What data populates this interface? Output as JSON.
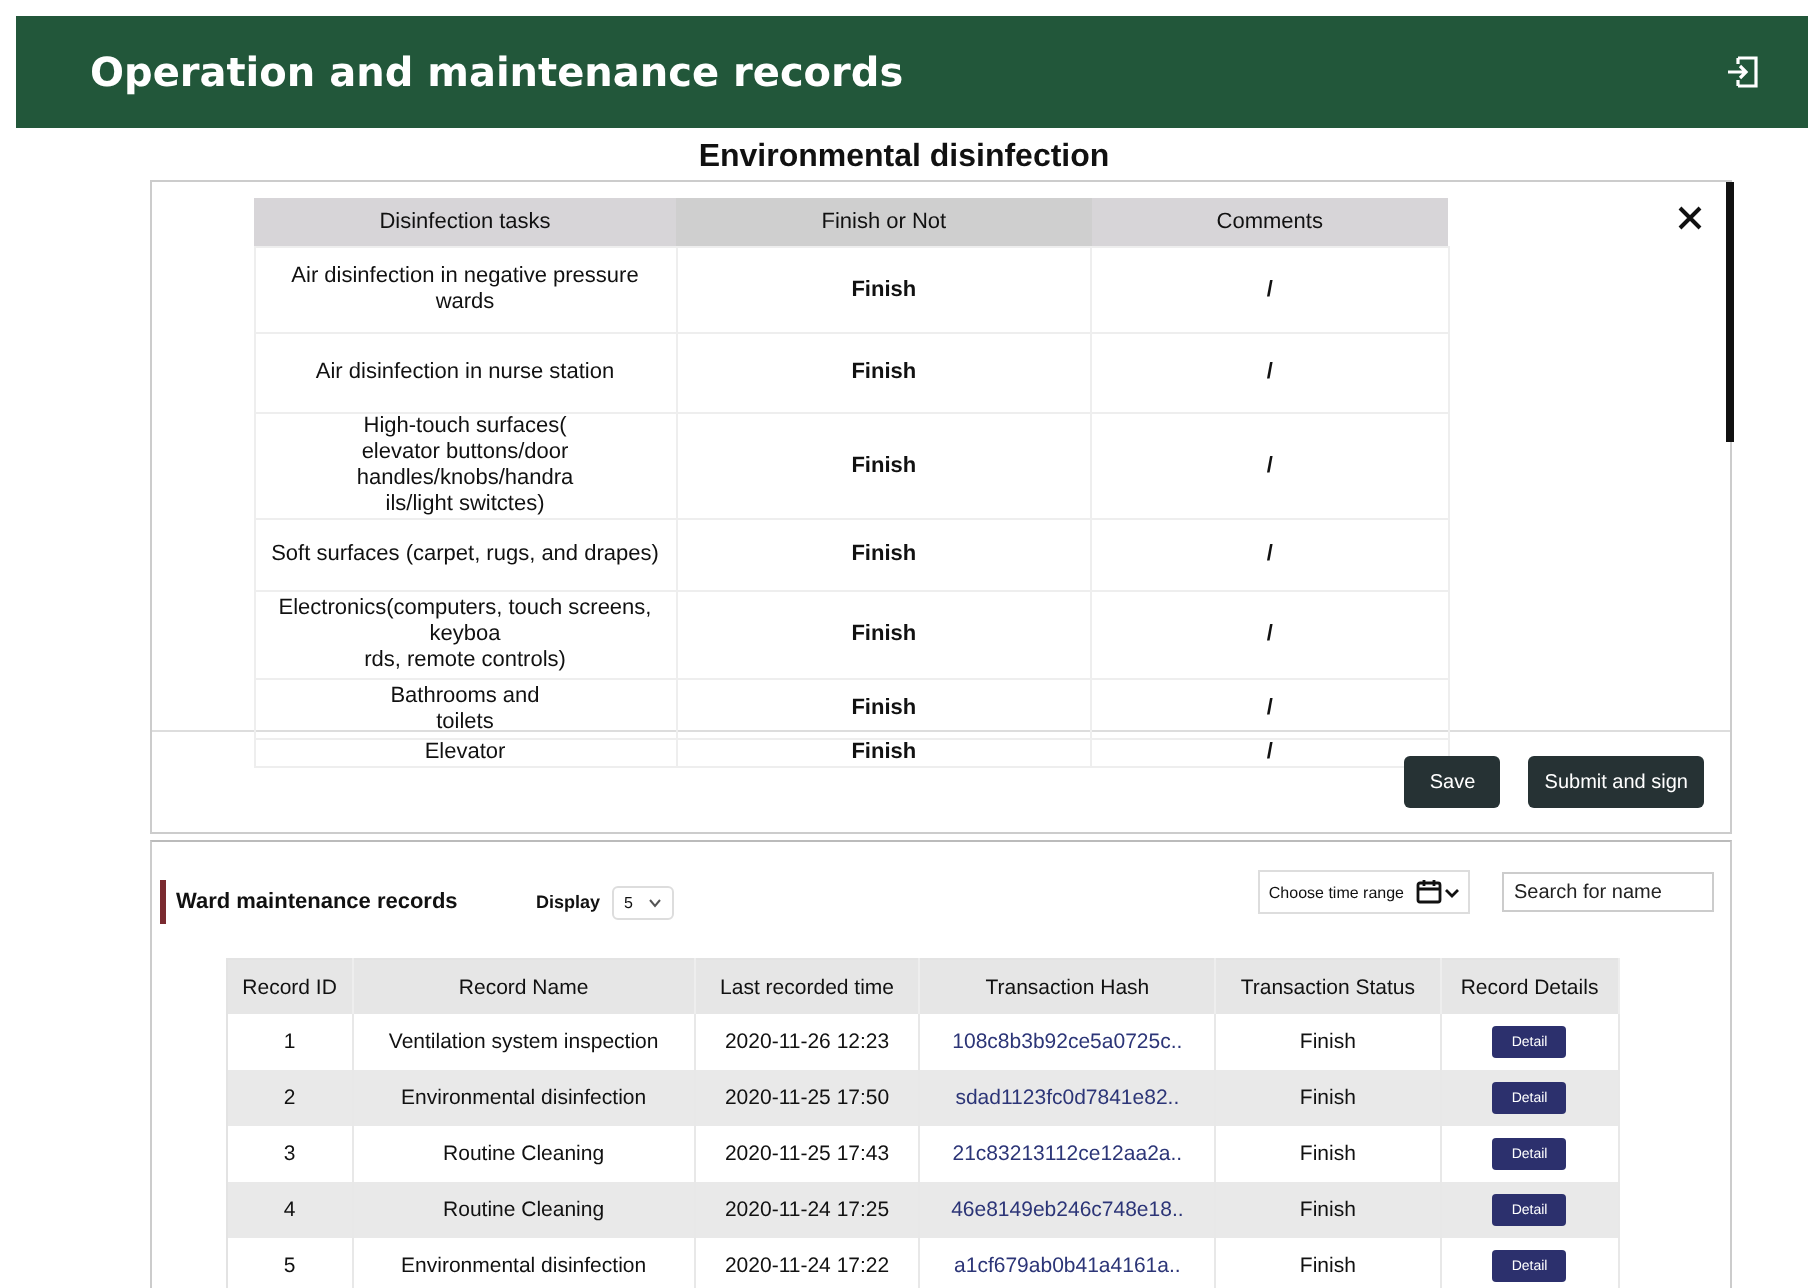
{
  "header": {
    "title": "Operation and maintenance records"
  },
  "dialog": {
    "title": "Environmental  disinfection",
    "columns": [
      "Disinfection tasks",
      "Finish or Not",
      "Comments"
    ],
    "rows": [
      {
        "task": "Air disinfection in negative pressure wards",
        "finish": "Finish",
        "comment": "/"
      },
      {
        "task": "Air disinfection in nurse station",
        "finish": "Finish",
        "comment": "/"
      },
      {
        "task": "High-touch surfaces(\nelevator buttons/door handles/knobs/handra\nils/light switctes)",
        "finish": "Finish",
        "comment": "/"
      },
      {
        "task": "Soft surfaces  (carpet, rugs, and drapes)",
        "finish": "Finish",
        "comment": "/"
      },
      {
        "task": "Electronics(computers, touch screens, keyboa\nrds, remote controls)",
        "finish": "Finish",
        "comment": "/"
      },
      {
        "task": "Bathrooms and\ntoilets",
        "finish": "Finish",
        "comment": "/"
      },
      {
        "task": "Elevator",
        "finish": "Finish",
        "comment": "/"
      }
    ],
    "buttons": [
      "Save",
      "Submit and sign"
    ]
  },
  "records": {
    "title": "Ward maintenance records",
    "display_label": "Display",
    "display_value": "5",
    "time_range": "Choose time range",
    "search": {
      "placeholder": "Search for name"
    },
    "columns": [
      "Record ID",
      "Record Name",
      "Last recorded time",
      "Transaction Hash",
      "Transaction Status",
      "Record Details"
    ],
    "rows": [
      {
        "id": "1",
        "name": "Ventilation system inspection",
        "time": "2020-11-26 12:23",
        "hash": "108c8b3b92ce5a0725c..",
        "status": "Finish",
        "action": "Detail"
      },
      {
        "id": "2",
        "name": "Environmental  disinfection",
        "time": "2020-11-25 17:50",
        "hash": "sdad1123fc0d7841e82..",
        "status": "Finish",
        "action": "Detail"
      },
      {
        "id": "3",
        "name": "Routine Cleaning",
        "time": "2020-11-25 17:43",
        "hash": "21c83213112ce12aa2a..",
        "status": "Finish",
        "action": "Detail"
      },
      {
        "id": "4",
        "name": "Routine Cleaning",
        "time": "2020-11-24 17:25",
        "hash": "46e8149eb246c748e18..",
        "status": "Finish",
        "action": "Detail"
      },
      {
        "id": "5",
        "name": "Environmental  disinfection",
        "time": "2020-11-24 17:22",
        "hash": "a1cf679ab0b41a4161a..",
        "status": "Finish",
        "action": "Detail"
      }
    ]
  }
}
